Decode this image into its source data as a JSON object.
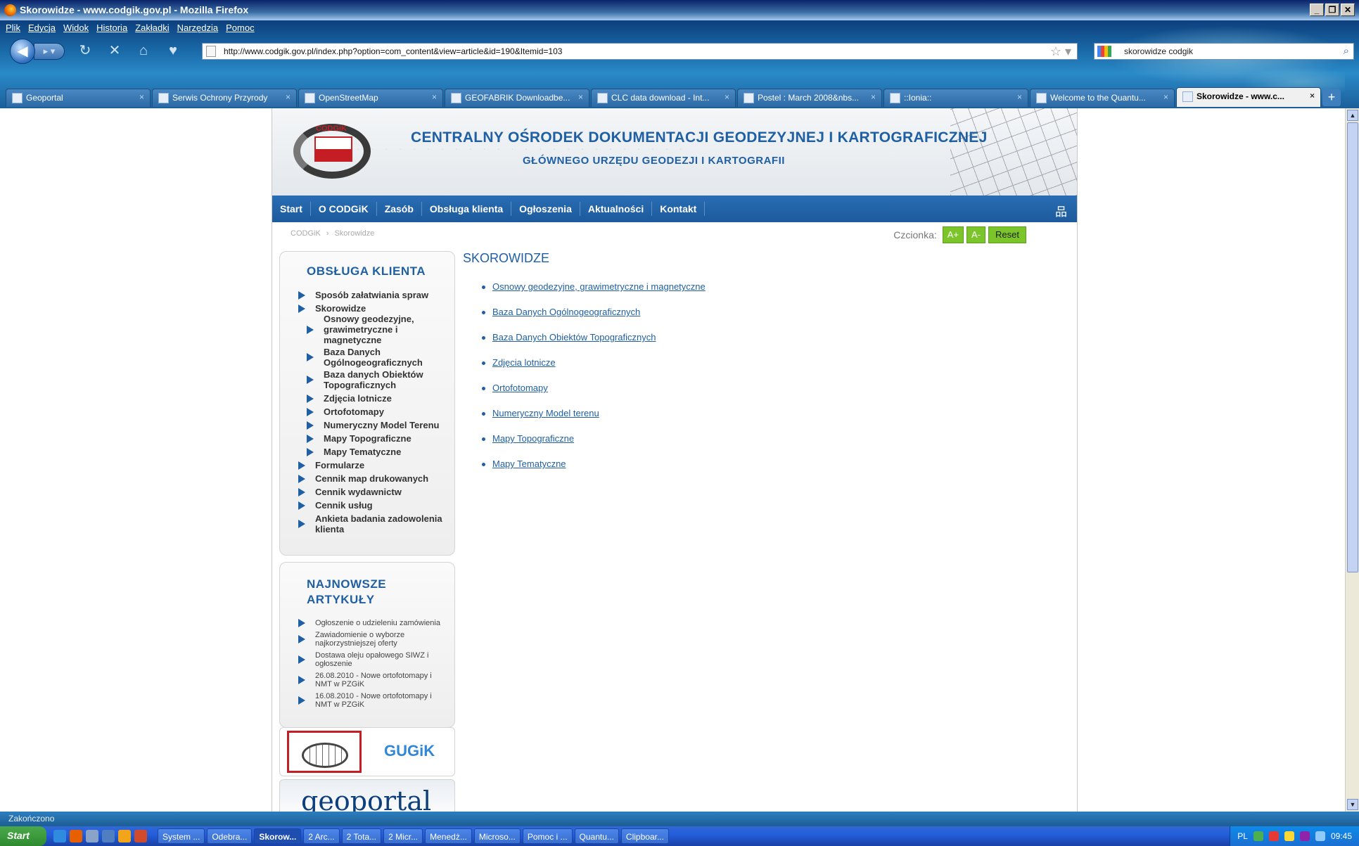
{
  "window": {
    "title": "Skorowidze - www.codgik.gov.pl - Mozilla Firefox"
  },
  "menubar": [
    "Plik",
    "Edycja",
    "Widok",
    "Historia",
    "Zakładki",
    "Narzędzia",
    "Pomoc"
  ],
  "navbar": {
    "url": "http://www.codgik.gov.pl/index.php?option=com_content&view=article&id=190&Itemid=103",
    "search_value": "skorowidze codgik"
  },
  "tabs": [
    {
      "label": "Geoportal",
      "active": false
    },
    {
      "label": "Serwis Ochrony Przyrody",
      "active": false
    },
    {
      "label": "OpenStreetMap",
      "active": false
    },
    {
      "label": "GEOFABRIK Downloadbe...",
      "active": false
    },
    {
      "label": "CLC data download - Int...",
      "active": false
    },
    {
      "label": "Postel : March 2008&nbs...",
      "active": false
    },
    {
      "label": "::Ionia::",
      "active": false
    },
    {
      "label": "Welcome to the Quantu...",
      "active": false
    },
    {
      "label": "Skorowidze - www.c...",
      "active": true
    }
  ],
  "site": {
    "logo_text": "CODGiK",
    "title_line1": "CENTRALNY OŚRODEK DOKUMENTACJI GEODEZYJNEJ I KARTOGRAFICZNEJ",
    "title_line2": "GŁÓWNEGO URZĘDU GEODEZJI I KARTOGRAFII",
    "nav": [
      "Start",
      "O CODGiK",
      "Zasób",
      "Obsługa klienta",
      "Ogłoszenia",
      "Aktualności",
      "Kontakt"
    ],
    "breadcrumb": [
      "CODGiK",
      "Skorowidze"
    ],
    "font_label": "Czcionka:",
    "font_buttons": [
      "A+",
      "A-",
      "Reset"
    ],
    "menu_title": "OBSŁUGA KLIENTA",
    "menu_items": [
      {
        "label": "Sposób załatwiania spraw",
        "level": 1
      },
      {
        "label": "Skorowidze",
        "level": 1
      },
      {
        "label": "Osnowy geodezyjne, grawimetryczne i magnetyczne",
        "level": 2
      },
      {
        "label": "Baza Danych Ogólnogeograficznych",
        "level": 2
      },
      {
        "label": "Baza danych Obiektów Topograficznych",
        "level": 2
      },
      {
        "label": "Zdjęcia lotnicze",
        "level": 2
      },
      {
        "label": "Ortofotomapy",
        "level": 2
      },
      {
        "label": "Numeryczny Model Terenu",
        "level": 2
      },
      {
        "label": "Mapy Topograficzne",
        "level": 2
      },
      {
        "label": "Mapy Tematyczne",
        "level": 2
      },
      {
        "label": "Formularze",
        "level": 1
      },
      {
        "label": "Cennik map drukowanych",
        "level": 1
      },
      {
        "label": "Cennik wydawnictw",
        "level": 1
      },
      {
        "label": "Cennik usług",
        "level": 1
      },
      {
        "label": "Ankieta badania zadowolenia klienta",
        "level": 1
      }
    ],
    "news_title": "NAJNOWSZE ARTYKUŁY",
    "news_items": [
      "Ogłoszenie o udzieleniu zamówienia",
      "Zawiadomienie o wyborze najkorzystniejszej oferty",
      "Dostawa oleju opałowego SIWZ i ogłoszenie",
      "26.08.2010 - Nowe ortofotomapy i NMT w PZGiK",
      "16.08.2010 - Nowe ortofotomapy i NMT w PZGiK"
    ],
    "banner_gugik": "GUGiK",
    "banner_geoportal": "geoportal",
    "content_title": "SKOROWIDZE",
    "content_links": [
      "Osnowy geodezyjne, grawimetryczne i magnetyczne",
      "Baza Danych Ogólnogeograficznych",
      "Baza Danych Obiektów Topograficznych",
      "Zdjęcia lotnicze",
      "Ortofotomapy",
      "Numeryczny Model terenu",
      "Mapy Topograficzne",
      "Mapy Tematyczne"
    ]
  },
  "status": "Zakończono",
  "taskbar": {
    "start": "Start",
    "buttons": [
      {
        "label": "System ...",
        "active": false
      },
      {
        "label": "Odebra...",
        "active": false
      },
      {
        "label": "Skorow...",
        "active": true
      },
      {
        "label": "2 Arc...",
        "active": false
      },
      {
        "label": "2 Tota...",
        "active": false
      },
      {
        "label": "2 Micr...",
        "active": false
      },
      {
        "label": "Menedż...",
        "active": false
      },
      {
        "label": "Microso...",
        "active": false
      },
      {
        "label": "Pomoc i ...",
        "active": false
      },
      {
        "label": "Quantu...",
        "active": false
      },
      {
        "label": "Clipboar...",
        "active": false
      }
    ],
    "language": "PL",
    "clock": "09:45"
  },
  "colors": {
    "brand_blue": "#1f5fa3",
    "nav_blue": "#2a6db3",
    "font_btn_green": "#7bc42a",
    "logo_red": "#c41d24"
  }
}
